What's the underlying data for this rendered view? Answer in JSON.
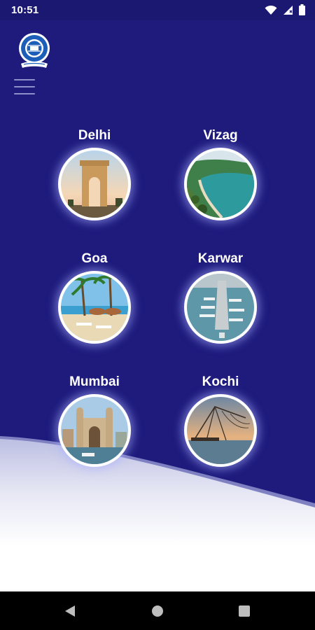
{
  "status_bar": {
    "time": "10:51"
  },
  "theme": {
    "primary": "#1e1b7d",
    "status_bar": "#1a1870",
    "label": "#ffffff",
    "wave_top": "#bdbfe3"
  },
  "header": {
    "logo_icon": "coast-guard-emblem-icon",
    "menu_icon": "hamburger-menu-icon"
  },
  "cities": [
    {
      "label": "Delhi",
      "image": "india-gate-photo"
    },
    {
      "label": "Vizag",
      "image": "vizag-coastline-photo"
    },
    {
      "label": "Goa",
      "image": "goa-beach-umbrellas-photo"
    },
    {
      "label": "Karwar",
      "image": "karwar-naval-harbour-photo"
    },
    {
      "label": "Mumbai",
      "image": "gateway-of-india-photo"
    },
    {
      "label": "Kochi",
      "image": "kochi-fishing-nets-photo"
    }
  ],
  "nav_bar": {
    "back_icon": "back-triangle-icon",
    "home_icon": "home-circle-icon",
    "recents_icon": "recents-square-icon"
  }
}
